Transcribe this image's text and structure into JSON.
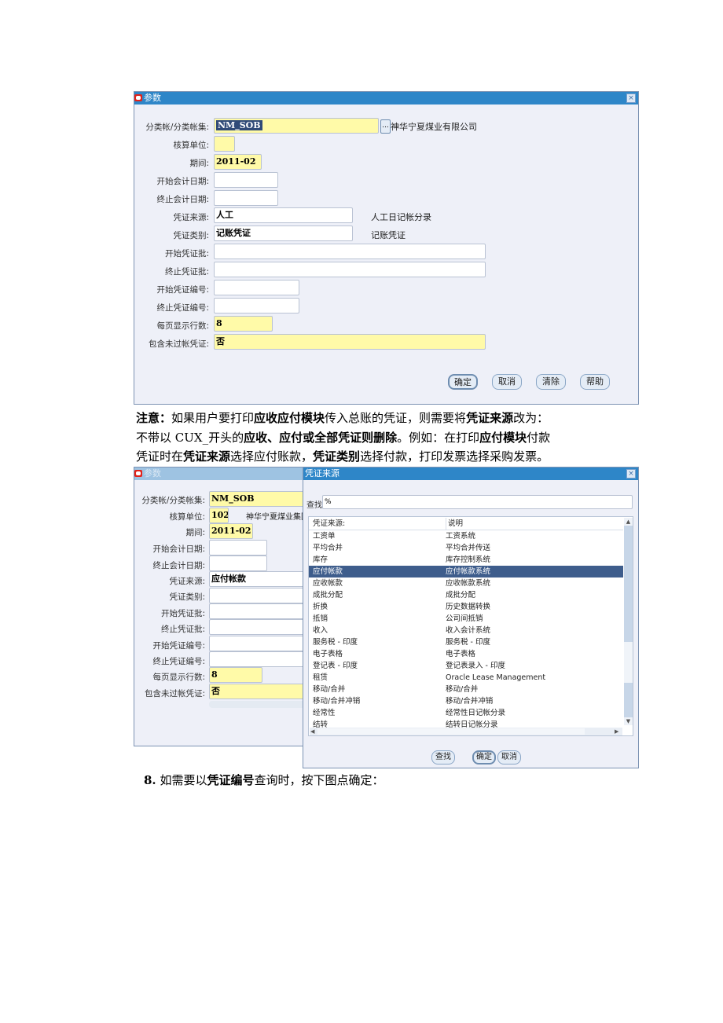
{
  "window1": {
    "title": "参数",
    "fields": [
      {
        "label": "分类帐/分类帐集:",
        "value": "NM_SOB",
        "required": true,
        "desc": "神华宁夏煤业有限公司"
      },
      {
        "label": "核算单位:",
        "value": "",
        "required": true
      },
      {
        "label": "期间:",
        "value": "2011-02",
        "required": true
      },
      {
        "label": "开始会计日期:",
        "value": ""
      },
      {
        "label": "终止会计日期:",
        "value": ""
      },
      {
        "label": "凭证来源:",
        "value": "人工",
        "desc": "人工日记帐分录"
      },
      {
        "label": "凭证类别:",
        "value": "记账凭证",
        "desc": "记账凭证"
      },
      {
        "label": "开始凭证批:",
        "value": ""
      },
      {
        "label": "终止凭证批:",
        "value": ""
      },
      {
        "label": "开始凭证编号:",
        "value": ""
      },
      {
        "label": "终止凭证编号:",
        "value": ""
      },
      {
        "label": "每页显示行数:",
        "value": "8",
        "required": true
      },
      {
        "label": "包含未过帐凭证:",
        "value": "否",
        "required": true
      }
    ],
    "lov_label": "...",
    "buttons": {
      "ok": "确定",
      "cancel": "取消",
      "clear": "清除",
      "help": "帮助"
    },
    "close_label": "×"
  },
  "note": {
    "line1": {
      "a": "注意：",
      "b": "如果用户要打印",
      "c": "应收应付模块",
      "d": "传入总账的凭证，则需要将",
      "e": "凭证来源",
      "f": "改为："
    },
    "line2": {
      "a": "不带以 CUX_开头的",
      "b": "应收、应付或全部凭证则删除",
      "c": "。例如：在打印",
      "d": "应付模块",
      "e": "付款"
    },
    "line3": {
      "a": "凭证时在",
      "b": "凭证来源",
      "c": "选择应付账款，",
      "d": "凭证类别",
      "e": "选择付款，打印发票选择采购发票。"
    }
  },
  "window2": {
    "title": "参数",
    "fields": [
      {
        "label": "分类帐/分类帐集:",
        "value": "NM_SOB",
        "required": true
      },
      {
        "label": "核算单位:",
        "value": "102",
        "required": true,
        "desc": "神华宁夏煤业集团"
      },
      {
        "label": "期间:",
        "value": "2011-02",
        "required": true
      },
      {
        "label": "开始会计日期:",
        "value": ""
      },
      {
        "label": "终止会计日期:",
        "value": ""
      },
      {
        "label": "凭证来源:",
        "value": "应付帐款"
      },
      {
        "label": "凭证类别:",
        "value": ""
      },
      {
        "label": "开始凭证批:",
        "value": ""
      },
      {
        "label": "终止凭证批:",
        "value": ""
      },
      {
        "label": "开始凭证编号:",
        "value": ""
      },
      {
        "label": "终止凭证编号:",
        "value": ""
      },
      {
        "label": "每页显示行数:",
        "value": "8",
        "required": true
      },
      {
        "label": "包含未过帐凭证:",
        "value": "否",
        "required": true
      }
    ]
  },
  "lov": {
    "title": "凭证来源",
    "find_label": "查找",
    "find_value": "%",
    "columns": [
      "凭证来源:",
      "说明"
    ],
    "rows": [
      [
        "工资单",
        "工资系统"
      ],
      [
        "平均合并",
        "平均合并传送"
      ],
      [
        "库存",
        "库存控制系统"
      ],
      [
        "应付帐款",
        "应付帐款系统"
      ],
      [
        "应收帐款",
        "应收帐款系统"
      ],
      [
        "成批分配",
        "成批分配"
      ],
      [
        "折换",
        "历史数据转换"
      ],
      [
        "抵销",
        "公司间抵销"
      ],
      [
        "收入",
        "收入会计系统"
      ],
      [
        "服务税 - 印度",
        "服务税 - 印度"
      ],
      [
        "电子表格",
        "电子表格"
      ],
      [
        "登记表 - 印度",
        "登记表录入 - 印度"
      ],
      [
        "租赁",
        "Oracle Lease Management"
      ],
      [
        "移动/合并",
        "移动/合并"
      ],
      [
        "移动/合并冲销",
        "移动/合并冲销"
      ],
      [
        "经常性",
        "经常性日记帐分录"
      ],
      [
        "结转",
        "结转日记帐分录"
      ]
    ],
    "selected_index": 3,
    "buttons": {
      "find": "查找",
      "ok": "确定",
      "cancel": "取消"
    },
    "close_label": "×"
  },
  "step8": {
    "num": "8.",
    "a": "如需要以",
    "b": "凭证编号",
    "c": "查询时，按下图点确定："
  }
}
